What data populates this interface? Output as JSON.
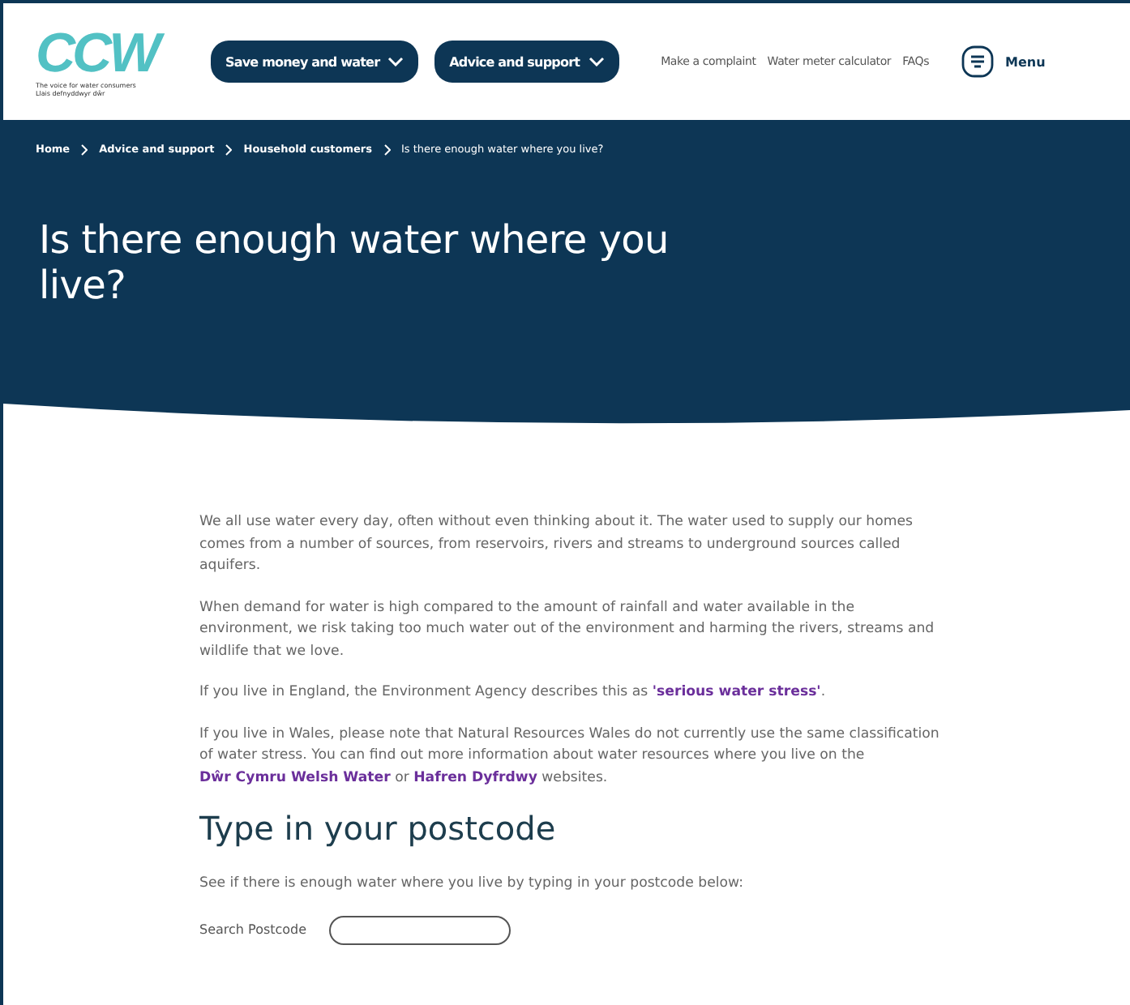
{
  "header": {
    "logo": {
      "text": "CCW",
      "tagline": [
        "The voice for water consumers",
        "Llais defnyddwyr dŵr"
      ]
    },
    "nav_buttons": [
      "Save money and water",
      "Advice and support"
    ],
    "links": [
      "Make a complaint",
      "Water meter calculator",
      "FAQs"
    ],
    "menu": "Menu"
  },
  "breadcrumb": [
    {
      "label": "Home",
      "current": false
    },
    {
      "label": "Advice and support",
      "current": false
    },
    {
      "label": "Household customers",
      "current": false
    },
    {
      "label": "Is there enough water where you live?",
      "current": true
    }
  ],
  "page_title": "Is there enough water where you live?",
  "paragraphs": [
    [
      {
        "text": "We all use water every day, often without even thinking about it. The water used to supply our homes comes from a number of sources, from reservoirs, rivers and streams to underground sources called aquifers."
      }
    ],
    [
      {
        "text": "When demand for water is high compared to the amount of rainfall and water available in the environment, we risk taking too much water out of the environment and harming the rivers, streams and wildlife that we love."
      }
    ],
    [
      {
        "text": "If you live in England, the Environment Agency describes this as "
      },
      {
        "text": "'serious water stress'",
        "kind": "link"
      },
      {
        "text": "."
      }
    ],
    [
      {
        "text": "If you live in Wales, please note that Natural Resources Wales do not currently use the same classification of water stress. You can find out more information about water resources where you live on the "
      },
      {
        "text": "Dŵr Cymru Welsh Water",
        "kind": "link"
      },
      {
        "text": " or "
      },
      {
        "text": "Hafren Dyfrdwy",
        "kind": "link"
      },
      {
        "text": " websites."
      }
    ]
  ],
  "postcode": {
    "heading": "Type in your postcode",
    "intro": "See if there is enough water where you live by typing in your postcode below:",
    "label": "Search Postcode"
  }
}
